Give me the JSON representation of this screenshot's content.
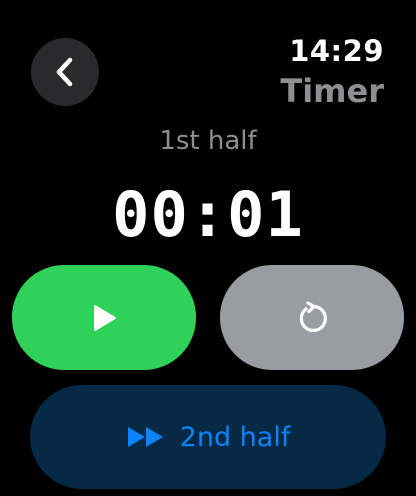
{
  "status": {
    "time": "14:29",
    "app_title": "Timer"
  },
  "timer": {
    "period": "1st half",
    "display": "00:01"
  },
  "controls": {
    "play_icon": "play-icon",
    "reset_icon": "reset-icon",
    "next_half_icon": "fast-forward-icon",
    "next_half_label": "2nd half"
  },
  "colors": {
    "play": "#30d158",
    "reset": "#9a9ca3",
    "next_half_bg": "#062945",
    "next_half_accent": "#0a84ff"
  }
}
